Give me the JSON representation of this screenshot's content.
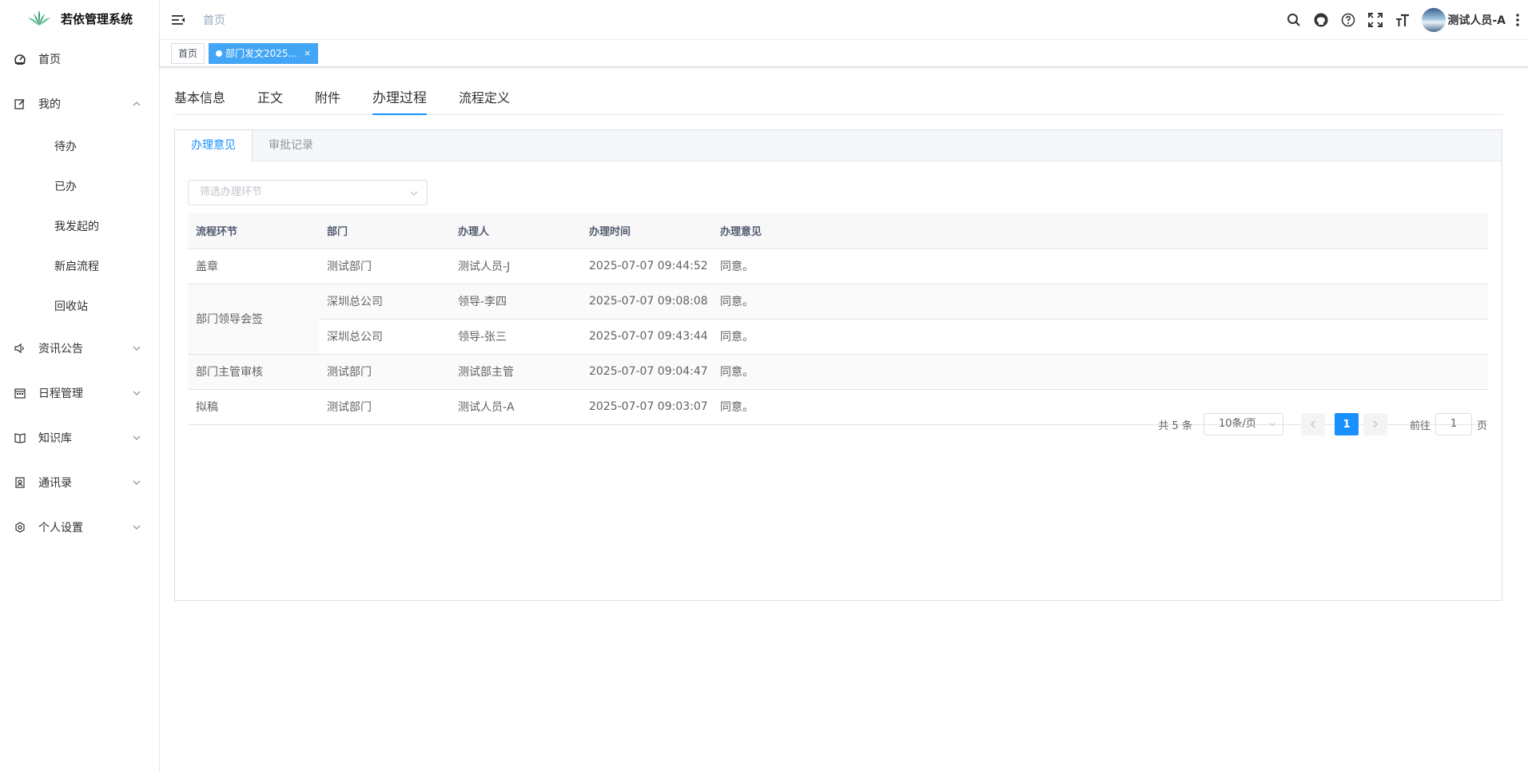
{
  "app": {
    "title": "若依管理系统"
  },
  "sidebar": {
    "items": [
      {
        "label": "首页",
        "icon": "dashboard-icon"
      },
      {
        "label": "我的",
        "icon": "edit-icon",
        "expanded": true,
        "children": [
          "待办",
          "已办",
          "我发起的",
          "新启流程",
          "回收站"
        ]
      },
      {
        "label": "资讯公告",
        "icon": "speaker-icon"
      },
      {
        "label": "日程管理",
        "icon": "calendar-icon"
      },
      {
        "label": "知识库",
        "icon": "book-icon"
      },
      {
        "label": "通讯录",
        "icon": "contacts-icon"
      },
      {
        "label": "个人设置",
        "icon": "settings-icon"
      }
    ]
  },
  "header": {
    "breadcrumb": "首页",
    "user_name": "测试人员-A"
  },
  "tagsview": {
    "home": "首页",
    "active": "部门发文2025...",
    "close": "×"
  },
  "tabs": [
    "基本信息",
    "正文",
    "附件",
    "办理过程",
    "流程定义"
  ],
  "active_tab": "办理过程",
  "subtabs": [
    "办理意见",
    "审批记录"
  ],
  "filter": {
    "placeholder": "筛选办理环节"
  },
  "table": {
    "columns": [
      "流程环节",
      "部门",
      "办理人",
      "办理时间",
      "办理意见"
    ],
    "rows": [
      {
        "step": "盖章",
        "dept": "测试部门",
        "handler": "测试人员-J",
        "time": "2025-07-07 09:44:52",
        "opinion": "同意。"
      },
      {
        "step": "部门领导会签",
        "dept": "深圳总公司",
        "handler": "领导-李四",
        "time": "2025-07-07 09:08:08",
        "opinion": "同意。"
      },
      {
        "step": "",
        "dept": "深圳总公司",
        "handler": "领导-张三",
        "time": "2025-07-07 09:43:44",
        "opinion": "同意。"
      },
      {
        "step": "部门主管审核",
        "dept": "测试部门",
        "handler": "测试部主管",
        "time": "2025-07-07 09:04:47",
        "opinion": "同意。"
      },
      {
        "step": "拟稿",
        "dept": "测试部门",
        "handler": "测试人员-A",
        "time": "2025-07-07 09:03:07",
        "opinion": "同意。"
      }
    ]
  },
  "pagination": {
    "total_text": "共 5 条",
    "page_size": "10条/页",
    "current_page": "1",
    "goto_label": "前往",
    "goto_value": "1",
    "page_unit": "页"
  },
  "colors": {
    "primary": "#1890ff",
    "tag_active": "#42a5f5"
  }
}
